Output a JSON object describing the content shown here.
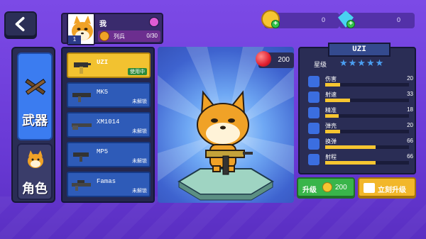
{
  "colors": {
    "accent": "#3b7cf0",
    "gold": "#f6c531",
    "selected": "#f2c230",
    "locked_item": "#2e5bb8"
  },
  "profile": {
    "level": "1",
    "name": "我",
    "rank_name": "列兵",
    "rank_progress": "0/30"
  },
  "currency": {
    "coins": "0",
    "gems": "0"
  },
  "tabs": [
    {
      "label": "武器",
      "icon": "guns-icon"
    },
    {
      "label": "角色",
      "icon": "dog-face-icon"
    }
  ],
  "weapons": [
    {
      "name": "UZI",
      "status": "使用中",
      "selected": true
    },
    {
      "name": "MK5",
      "status": "未解锁",
      "selected": false
    },
    {
      "name": "XM1014",
      "status": "未解锁",
      "selected": false
    },
    {
      "name": "MP5",
      "status": "未解锁",
      "selected": false
    },
    {
      "name": "Famas",
      "status": "未解锁",
      "selected": false
    }
  ],
  "price": {
    "value": "200",
    "icon": "red-ball-icon"
  },
  "stats": {
    "title": "UZI",
    "star_label": "星级",
    "stars": 5,
    "rows": [
      {
        "label": "伤害",
        "value": "20",
        "fill": 0.18,
        "icon": "damage-icon"
      },
      {
        "label": "射速",
        "value": "33",
        "fill": 0.3,
        "icon": "fire-rate-icon"
      },
      {
        "label": "精准",
        "value": "18",
        "fill": 0.16,
        "icon": "crosshair-icon"
      },
      {
        "label": "弹壳",
        "value": "20",
        "fill": 0.18,
        "icon": "bullet-icon"
      },
      {
        "label": "换弹",
        "value": "66",
        "fill": 0.6,
        "icon": "reload-icon"
      },
      {
        "label": "射程",
        "value": "66",
        "fill": 0.6,
        "icon": "range-icon"
      }
    ]
  },
  "buttons": {
    "upgrade_label": "升级",
    "upgrade_cost": "200",
    "instant_label": "立刻升级"
  }
}
